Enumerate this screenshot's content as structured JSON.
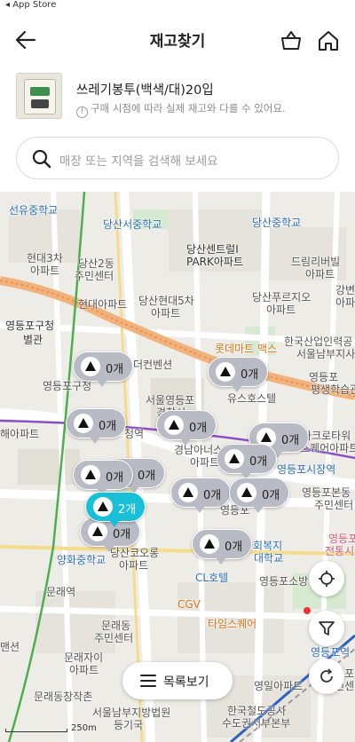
{
  "status_bar": {
    "back_app": "◂ App Store"
  },
  "header": {
    "title": "재고찾기"
  },
  "product": {
    "name": "쓰레기봉투(백색/대)20입",
    "notice": "구매 시점에 따라 실제 재고와 다를 수 있어요."
  },
  "search": {
    "placeholder": "매장 또는 지역을 검색해 보세요"
  },
  "map": {
    "labels": [
      "선유중학교",
      "당산서중학교",
      "당산중학교",
      "현대3차",
      "아파트",
      "당산2동",
      "주민센터",
      "현대아파트",
      "당산센트럴I",
      "PARK아파트",
      "드림리버빌",
      "아파트",
      "당산현대5차",
      "아파트",
      "당산푸르지오",
      "아파트",
      "강변",
      "아파트",
      "영등포구청",
      "별관",
      "롯데마트 맥스",
      "한국산업인력공",
      "서울남부지사",
      "영등포",
      "평생학습관",
      "더컨벤션",
      "영등포구청",
      "서울영등포",
      "경찰서",
      "유스호스텔",
      "해아파트",
      "청역",
      "경남아너스빌",
      "아파트",
      "아크로타워",
      "스퀘어아파트",
      "영등포시장역",
      "영등포본동",
      "주민센터",
      "영등포",
      "양화중학교",
      "당산코오롱",
      "아파트",
      "사회복지",
      "대학교",
      "영등포",
      "전통시장",
      "문래역",
      "CL호텔",
      "영등포소방",
      "CGV",
      "타임스퀘어",
      "문래동",
      "주민센터",
      "문래자이",
      "아파트",
      "맨션",
      "영등포역",
      "영일아파트",
      "문래동창작촌",
      "서울남부지방법원",
      "등기국",
      "한국철도공사",
      "수도권서부본부",
      "영등포",
      "주민센"
    ],
    "stock_pins": [
      "0개",
      "0개",
      "0개",
      "0개",
      "0개",
      "0개",
      "0개",
      "0개",
      "0개",
      "0개",
      "0개",
      "2개",
      "0개"
    ],
    "scale_text": "250m"
  },
  "list_button": {
    "label": "목록보기"
  },
  "colors": {
    "accent": "#18bfd6",
    "pin_inactive": "#b8bac4",
    "alert_dot": "#e8343a"
  }
}
